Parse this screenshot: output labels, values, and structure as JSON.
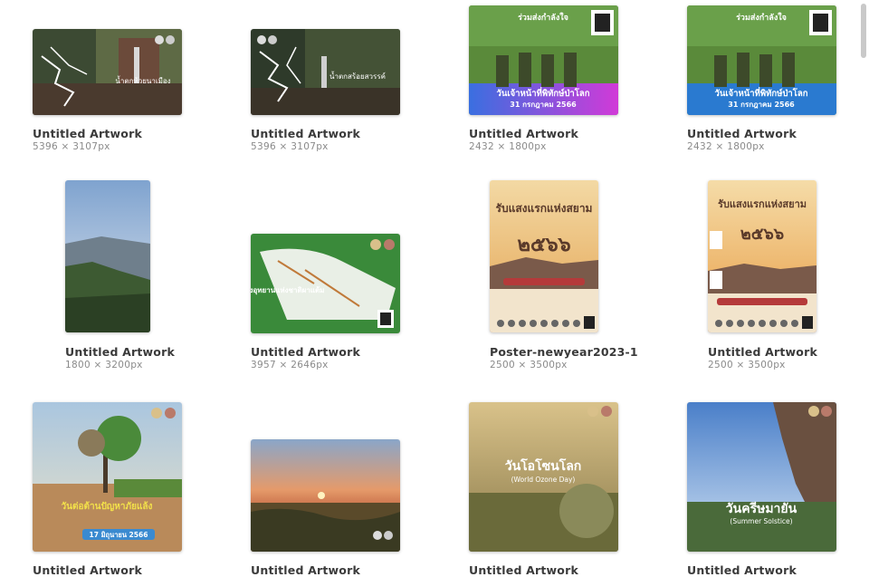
{
  "gallery": {
    "items": [
      {
        "title": "Untitled Artwork",
        "dims": "5396 × 3107px",
        "icon": "waterfall-map-image",
        "poster_text": "น้ำตกห้วยนาเมือง"
      },
      {
        "title": "Untitled Artwork",
        "dims": "5396 × 3107px",
        "icon": "waterfall-map-image",
        "poster_text": "น้ำตกสร้อยสวรรค์"
      },
      {
        "title": "Untitled Artwork",
        "dims": "2432 × 1800px",
        "icon": "ranger-day-poster",
        "poster_heading": "ร่วมส่งกำลังใจ",
        "poster_text": "วันเจ้าหน้าที่พิทักษ์ป่าโลก",
        "poster_date": "31 กรกฎาคม 2566"
      },
      {
        "title": "Untitled Artwork",
        "dims": "2432 × 1800px",
        "icon": "ranger-day-poster",
        "poster_heading": "ร่วมส่งกำลังใจ",
        "poster_text": "วันเจ้าหน้าที่พิทักษ์ป่าโลก",
        "poster_date": "31 กรกฎาคม 2566"
      },
      {
        "title": "Untitled Artwork",
        "dims": "1800 × 3200px",
        "icon": "cliff-landscape-image"
      },
      {
        "title": "Untitled Artwork",
        "dims": "3957 × 2646px",
        "icon": "park-map-image",
        "poster_text": "แผนผังอุทยานแห่งชาติผาแต้ม"
      },
      {
        "title": "Poster-newyear2023-1",
        "dims": "2500 × 3500px",
        "icon": "newyear-poster",
        "poster_text": "รับแสงแรกแห่งสยาม",
        "poster_year": "๒๕๖๖"
      },
      {
        "title": "Untitled Artwork",
        "dims": "2500 × 3500px",
        "icon": "newyear-poster",
        "poster_text": "รับแสงแรกแห่งสยาม",
        "poster_year": "๒๕๖๖"
      },
      {
        "title": "Untitled Artwork",
        "dims": "",
        "icon": "desertification-poster",
        "poster_text": "วันต่อต้านปัญหาภัยแล้ง",
        "poster_date": "17 มิถุนายน 2566"
      },
      {
        "title": "Untitled Artwork",
        "dims": "",
        "icon": "sunset-landscape-image"
      },
      {
        "title": "Untitled Artwork",
        "dims": "",
        "icon": "ozone-day-poster",
        "poster_text": "วันโอโซนโลก",
        "poster_sub": "(World Ozone Day)"
      },
      {
        "title": "Untitled Artwork",
        "dims": "",
        "icon": "summer-solstice-poster",
        "poster_text": "วันครีษมายัน",
        "poster_sub": "(Summer Solstice)"
      }
    ]
  }
}
